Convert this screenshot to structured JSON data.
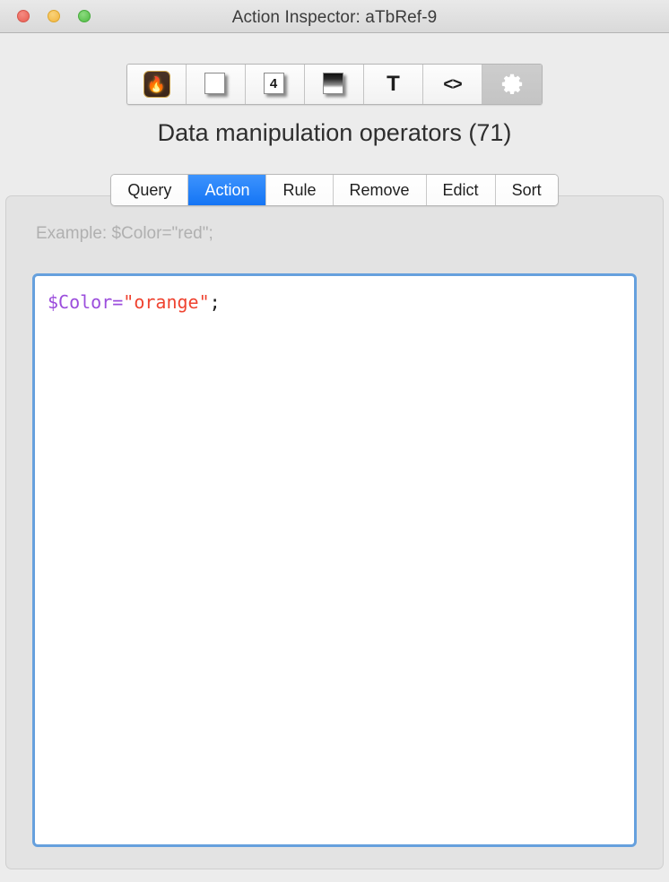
{
  "window": {
    "title": "Action Inspector: aTbRef-9",
    "controls": [
      {
        "name": "close",
        "color": "#ec6a5f"
      },
      {
        "name": "minimize",
        "color": "#f4bd4f"
      },
      {
        "name": "zoom",
        "color": "#61c454"
      }
    ]
  },
  "toolbar": {
    "items": [
      {
        "icon": "app-flame-icon",
        "label": "",
        "selected": false
      },
      {
        "icon": "note-card-icon",
        "label": "",
        "selected": false
      },
      {
        "icon": "note-count-icon",
        "label": "4",
        "selected": false
      },
      {
        "icon": "note-gradient-icon",
        "label": "",
        "selected": false
      },
      {
        "icon": "text-icon",
        "label": "T",
        "selected": false
      },
      {
        "icon": "code-icon",
        "label": "<>",
        "selected": false
      },
      {
        "icon": "gear-icon",
        "label": "",
        "selected": true
      }
    ]
  },
  "heading": {
    "text": "Data manipulation operators (71)"
  },
  "tabs": {
    "items": [
      {
        "label": "Query",
        "active": false
      },
      {
        "label": "Action",
        "active": true
      },
      {
        "label": "Rule",
        "active": false
      },
      {
        "label": "Remove",
        "active": false
      },
      {
        "label": "Edict",
        "active": false
      },
      {
        "label": "Sort",
        "active": false
      }
    ],
    "active_label": "Action",
    "active_color": "#1d7ffc"
  },
  "hint": {
    "text": "Example: $Color=\"red\";"
  },
  "editor": {
    "value": "$Color=\"orange\";",
    "focused": true,
    "focus_ring_color": "#66a0dd",
    "tokens": [
      {
        "text": "$Color=",
        "type": "variable",
        "color": "#9b4ddc"
      },
      {
        "text": "\"orange\"",
        "type": "string",
        "color": "#ef4330"
      },
      {
        "text": ";",
        "type": "punctuation",
        "color": "#1a1a1a"
      }
    ]
  }
}
